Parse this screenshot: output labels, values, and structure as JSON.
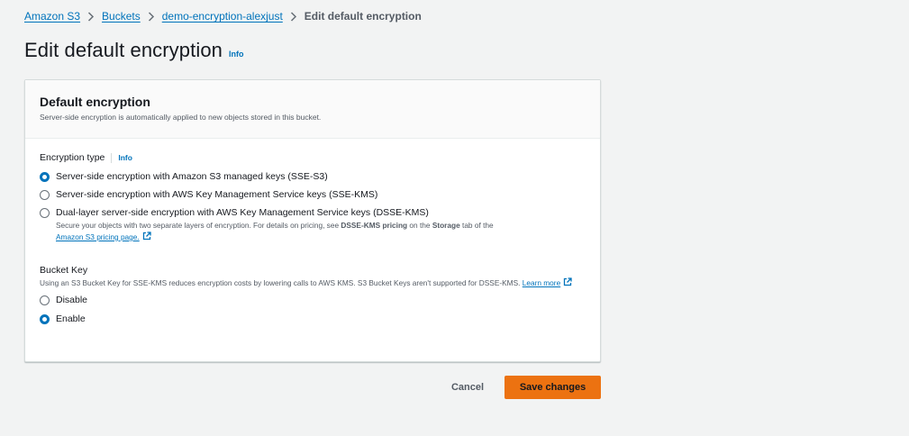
{
  "breadcrumb": {
    "items": [
      "Amazon S3",
      "Buckets",
      "demo-encryption-alexjust"
    ],
    "current": "Edit default encryption"
  },
  "page": {
    "title": "Edit default encryption",
    "info": "Info"
  },
  "panel": {
    "title": "Default encryption",
    "description": "Server-side encryption is automatically applied to new objects stored in this bucket."
  },
  "encryption_type": {
    "label": "Encryption type",
    "info": "Info",
    "options": [
      {
        "label": "Server-side encryption with Amazon S3 managed keys (SSE-S3)",
        "selected": true
      },
      {
        "label": "Server-side encryption with AWS Key Management Service keys (SSE-KMS)",
        "selected": false
      },
      {
        "label": "Dual-layer server-side encryption with AWS Key Management Service keys (DSSE-KMS)",
        "selected": false
      }
    ],
    "dsse_desc_1": "Secure your objects with two separate layers of encryption. For details on pricing, see ",
    "dsse_desc_bold_1": "DSSE-KMS pricing",
    "dsse_desc_2": " on the ",
    "dsse_desc_bold_2": "Storage",
    "dsse_desc_3": " tab of the",
    "pricing_link": "Amazon S3 pricing page."
  },
  "bucket_key": {
    "label": "Bucket Key",
    "description": "Using an S3 Bucket Key for SSE-KMS reduces encryption costs by lowering calls to AWS KMS. S3 Bucket Keys aren't supported for DSSE-KMS.",
    "learn_more": "Learn more",
    "options": [
      {
        "label": "Disable",
        "selected": false
      },
      {
        "label": "Enable",
        "selected": true
      }
    ]
  },
  "actions": {
    "cancel": "Cancel",
    "save": "Save changes"
  },
  "colors": {
    "link": "#0073bb",
    "primary_button": "#ec7211",
    "background": "#f2f3f3"
  }
}
